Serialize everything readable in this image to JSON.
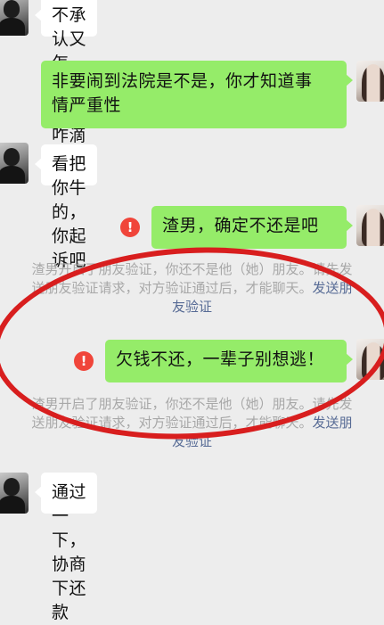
{
  "chat": {
    "msg1": "不承认又怎样，你能咋滴",
    "msg2_line1": "非要闹到法院是不是，你才知道事",
    "msg2_line2": "情严重性",
    "msg3": "看把你牛的，你起诉吧",
    "msg4": "渣男，确定不还是吧",
    "sys1_line1": "渣男开启了朋友验证，你还不是他（她）朋友。请先发",
    "sys1_line2": "送朋友验证请求，对方验证通过后，才能聊天。",
    "sys1_link1": "发送朋",
    "sys1_link2": "友验证",
    "msg5": "欠钱不还，一辈子别想逃！",
    "sys2_line1": "渣男开启了朋友验证，你还不是他（她）朋友。请先发",
    "sys2_line2": "送朋友验证请求，对方验证通过后，才能聊天。",
    "sys2_link1": "发送朋",
    "sys2_link2": "友验证",
    "msg6": "通过一下，协商下还款",
    "error_mark": "!"
  },
  "colors": {
    "background": "#ededed",
    "sent_bubble": "#95ec69",
    "received_bubble": "#ffffff",
    "error": "#f0453a",
    "link": "#576b95",
    "annotation_circle": "#d81e1e"
  }
}
